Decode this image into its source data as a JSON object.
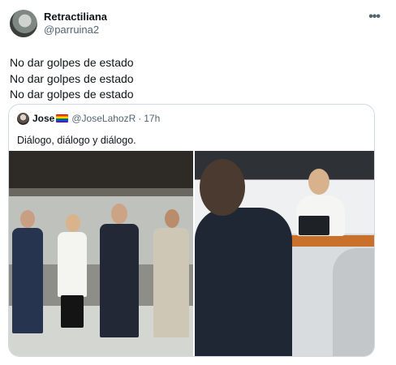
{
  "tweet": {
    "display_name": "Retractiliana",
    "handle": "@parruina2",
    "more_icon": "more-horizontal-icon",
    "lines": [
      "No dar golpes de estado",
      "No dar golpes de estado",
      "No dar golpes de estado"
    ]
  },
  "quote": {
    "display_name": "Jose",
    "flag_icon": "rainbow-flag-icon",
    "handle": "@JoseLahozR",
    "separator": "·",
    "time": "17h",
    "text": "Diálogo, diálogo y diálogo."
  },
  "colors": {
    "text": "#0f1419",
    "secondary": "#536471",
    "border": "#cfd9de"
  }
}
